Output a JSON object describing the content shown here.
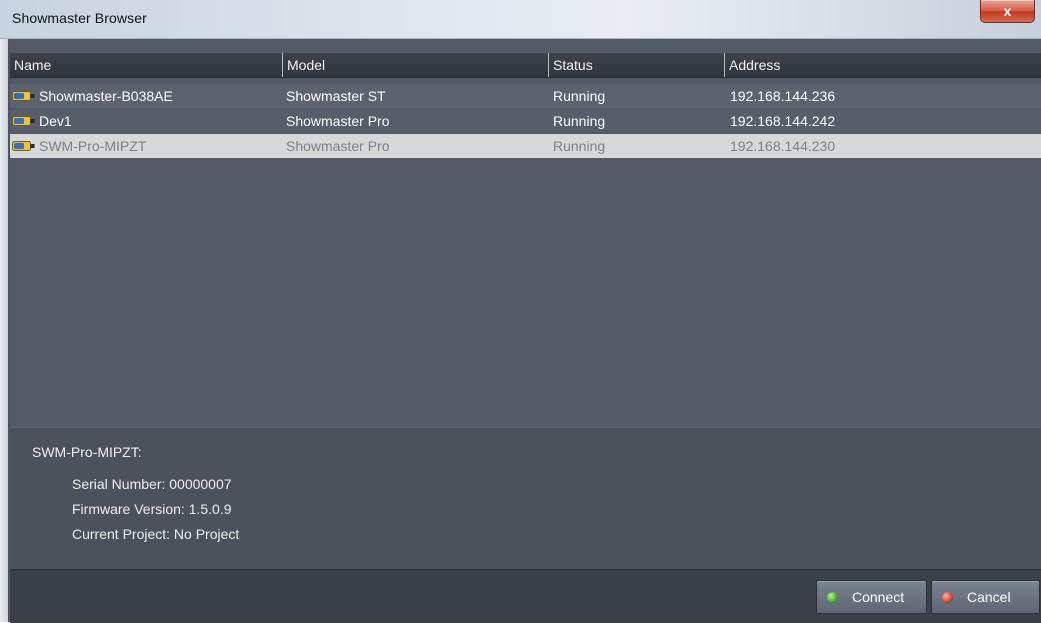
{
  "window": {
    "title": "Showmaster Browser",
    "close_label": "x"
  },
  "table": {
    "columns": [
      "Name",
      "Model",
      "Status",
      "Address"
    ],
    "rows": [
      {
        "name": "Showmaster-B038AE",
        "model": "Showmaster ST",
        "status": "Running",
        "address": "192.168.144.236",
        "icon": "device-icon",
        "selected": false
      },
      {
        "name": "Dev1",
        "model": "Showmaster Pro",
        "status": "Running",
        "address": "192.168.144.242",
        "icon": "device-icon",
        "selected": false
      },
      {
        "name": "SWM-Pro-MIPZT",
        "model": "Showmaster Pro",
        "status": "Running",
        "address": "192.168.144.230",
        "icon": "device-icon",
        "selected": true
      }
    ]
  },
  "detail": {
    "title": "SWM-Pro-MIPZT:",
    "serial": "Serial Number: 00000007",
    "firmware": "Firmware Version: 1.5.0.9",
    "project": "Current Project: No Project"
  },
  "buttons": {
    "connect_label": "Connect",
    "cancel_label": "Cancel"
  },
  "colors": {
    "panel": "#4f545e",
    "selected_row": "#d7d8da",
    "connect_led": "#3ea82a",
    "cancel_led": "#d2432c"
  }
}
